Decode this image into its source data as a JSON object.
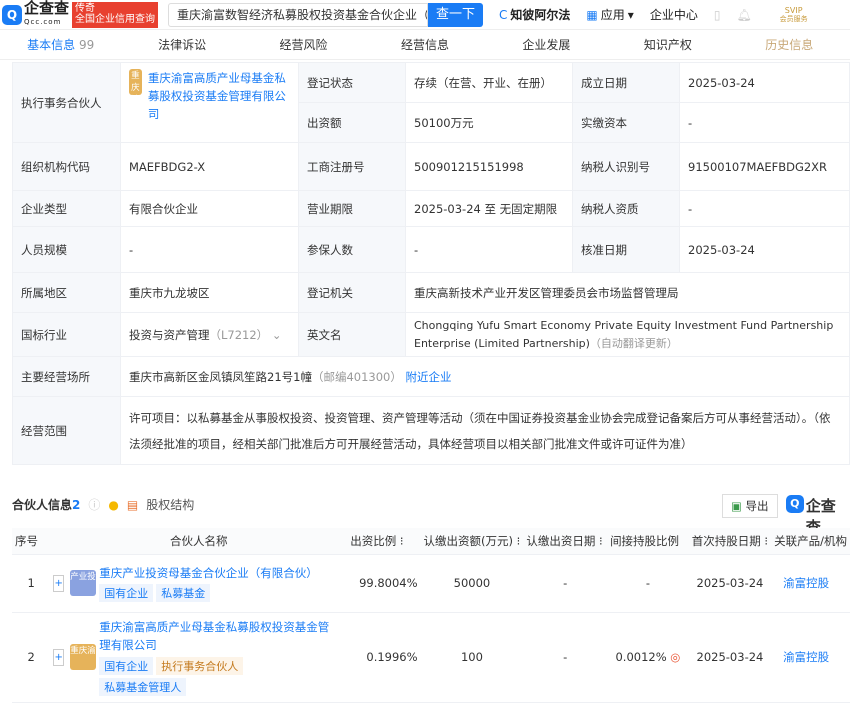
{
  "header": {
    "logo_cn": "企查查",
    "logo_en": "Qcc.com",
    "slogan_top": "传奇",
    "slogan_bottom": "全国企业信用查询",
    "search_value": "重庆渝富数智经济私募股权投资基金合伙企业（",
    "search_button": "查一下",
    "zhibi": "知彼阿尔法",
    "apps": "应用",
    "center": "企业中心",
    "svip": "SVIP",
    "svip_sub": "会员服务"
  },
  "tabs": [
    {
      "label": "基本信息",
      "count": "99"
    },
    {
      "label": "法律诉讼"
    },
    {
      "label": "经营风险"
    },
    {
      "label": "经营信息"
    },
    {
      "label": "企业发展"
    },
    {
      "label": "知识产权"
    },
    {
      "label": "历史信息"
    }
  ],
  "info": {
    "partner_label": "执行事务合伙人",
    "partner_badge": "重庆渝富",
    "partner_name": "重庆渝富高质产业母基金私募股权投资基金管理有限公司",
    "status_label": "登记状态",
    "status": "存续（在营、开业、在册）",
    "found_label": "成立日期",
    "found": "2025-03-24",
    "capital_label": "出资额",
    "capital": "50100万元",
    "paid_label": "实缴资本",
    "paid": "-",
    "org_label": "组织机构代码",
    "org": "MAEFBDG2-X",
    "reg_label": "工商注册号",
    "reg": "500901215151998",
    "tax_label": "纳税人识别号",
    "tax": "91500107MAEFBDG2XR",
    "type_label": "企业类型",
    "type": "有限合伙企业",
    "term_label": "营业期限",
    "term": "2025-03-24 至 无固定期限",
    "taxq_label": "纳税人资质",
    "taxq": "-",
    "staff_label": "人员规模",
    "staff": "-",
    "insured_label": "参保人数",
    "insured": "-",
    "approve_label": "核准日期",
    "approve": "2025-03-24",
    "region_label": "所属地区",
    "region": "重庆市九龙坡区",
    "authority_label": "登记机关",
    "authority": "重庆高新技术产业开发区管理委员会市场监督管理局",
    "industry_label": "国标行业",
    "industry": "投资与资产管理",
    "industry_code": "（L7212）",
    "en_label": "英文名",
    "en": "Chongqing Yufu Smart Economy Private Equity Investment Fund Partnership Enterprise (Limited Partnership)",
    "en_note": "（自动翻译更新）",
    "addr_label": "主要经营场所",
    "addr": "重庆市高新区金凤镇凤笙路21号1幢",
    "postcode": "（邮编401300）",
    "nearby": "附近企业",
    "scope_label": "经营范围",
    "scope": "许可项目：以私募基金从事股权投资、投资管理、资产管理等活动（须在中国证券投资基金业协会完成登记备案后方可从事经营活动）。（依法须经批准的项目，经相关部门批准后方可开展经营活动，具体经营项目以相关部门批准文件或许可证件为准）"
  },
  "partners": {
    "title": "合伙人信息",
    "count": "2",
    "equity": "股权结构",
    "export": "导出",
    "brand": "企查查",
    "columns": [
      "序号",
      "合伙人名称",
      "出资比例",
      "认缴出资额(万元)",
      "认缴出资日期",
      "间接持股比例",
      "首次持股日期",
      "关联产品/机构"
    ],
    "rows": [
      {
        "no": "1",
        "badge": "产业投资",
        "name": "重庆产业投资母基金合伙企业（有限合伙）",
        "tags": [
          "国有企业",
          "私募基金"
        ],
        "ratio": "99.8004%",
        "amount": "50000",
        "date": "-",
        "indirect": "-",
        "first": "2025-03-24",
        "product": "渝富控股"
      },
      {
        "no": "2",
        "badge": "重庆渝富",
        "name": "重庆渝富高质产业母基金私募股权投资基金管理有限公司",
        "tags": [
          "国有企业",
          "执行事务合伙人",
          "私募基金管理人"
        ],
        "ratio": "0.1996%",
        "amount": "100",
        "date": "-",
        "indirect": "0.0012%",
        "first": "2025-03-24",
        "product": "渝富控股"
      }
    ]
  }
}
